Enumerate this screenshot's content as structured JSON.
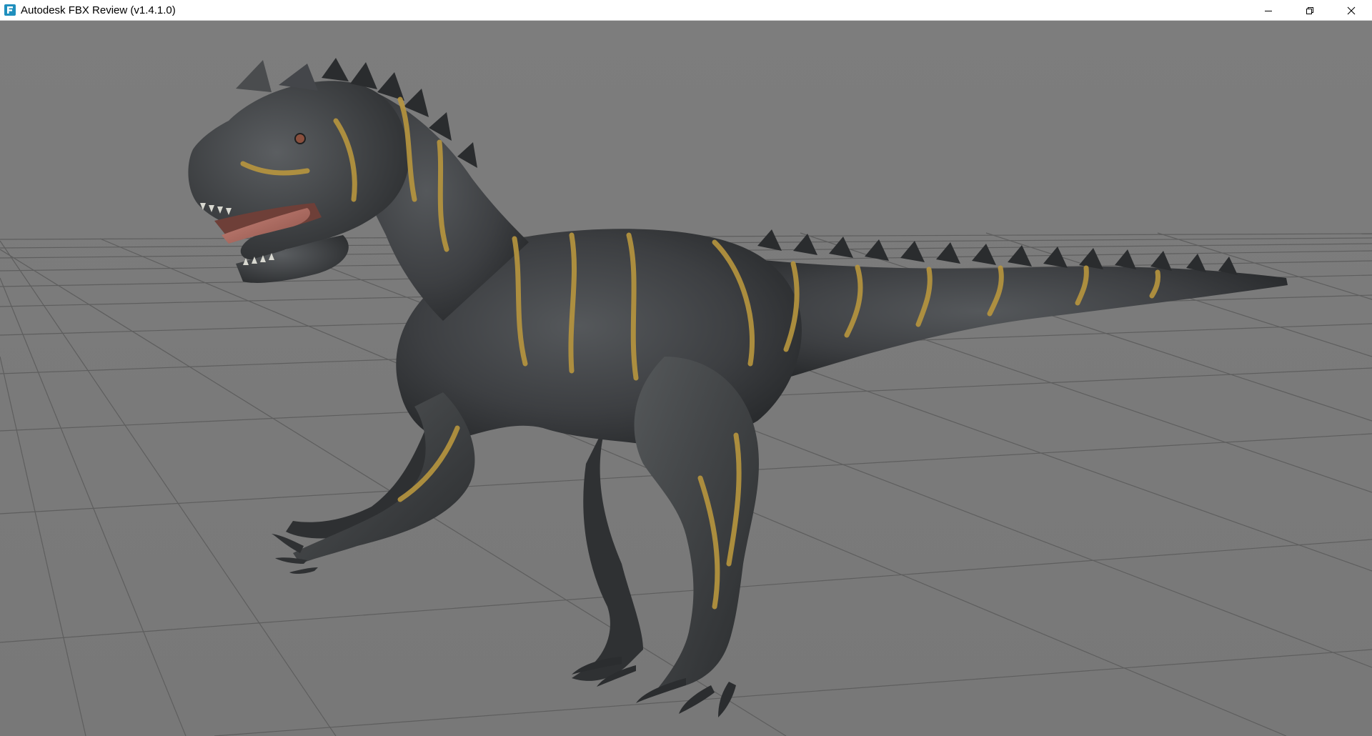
{
  "window": {
    "title": "Autodesk FBX Review (v1.4.1.0)",
    "app_icon": "fbx-review-icon",
    "controls": {
      "minimize_icon": "minimize-icon",
      "restore_icon": "restore-icon",
      "close_icon": "close-icon"
    }
  },
  "viewport": {
    "model_name": "",
    "background_color": "#7b7b7b",
    "grid_line_color": "#5a5a5a",
    "model_base_color": "#3d3f41",
    "model_stripe_color": "#b8963e",
    "mouth_color": "#b06a5e"
  }
}
